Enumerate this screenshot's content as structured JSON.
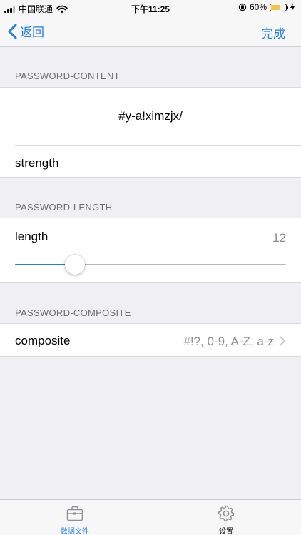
{
  "status_bar": {
    "carrier": "中国联通",
    "time": "下午11:25",
    "battery": "60%",
    "battery_level": 0.6
  },
  "nav": {
    "back_label": "返回",
    "done_label": "完成"
  },
  "sections": {
    "content": {
      "header": "PASSWORD-CONTENT",
      "password": "#y-a!ximzjx/",
      "strength_label": "strength"
    },
    "length": {
      "header": "PASSWORD-LENGTH",
      "label": "length",
      "value": "12",
      "slider_fraction": 0.2
    },
    "composite": {
      "header": "PASSWORD-COMPOSITE",
      "label": "composite",
      "value": "#!?, 0-9, A-Z, a-z"
    }
  },
  "tabs": [
    {
      "label": "数据文件",
      "icon": "briefcase-icon",
      "active": true
    },
    {
      "label": "设置",
      "icon": "gear-icon",
      "active": false
    }
  ],
  "colors": {
    "accent": "#1f7cf3",
    "background": "#efeff4",
    "secondary_text": "#8e8e93"
  }
}
